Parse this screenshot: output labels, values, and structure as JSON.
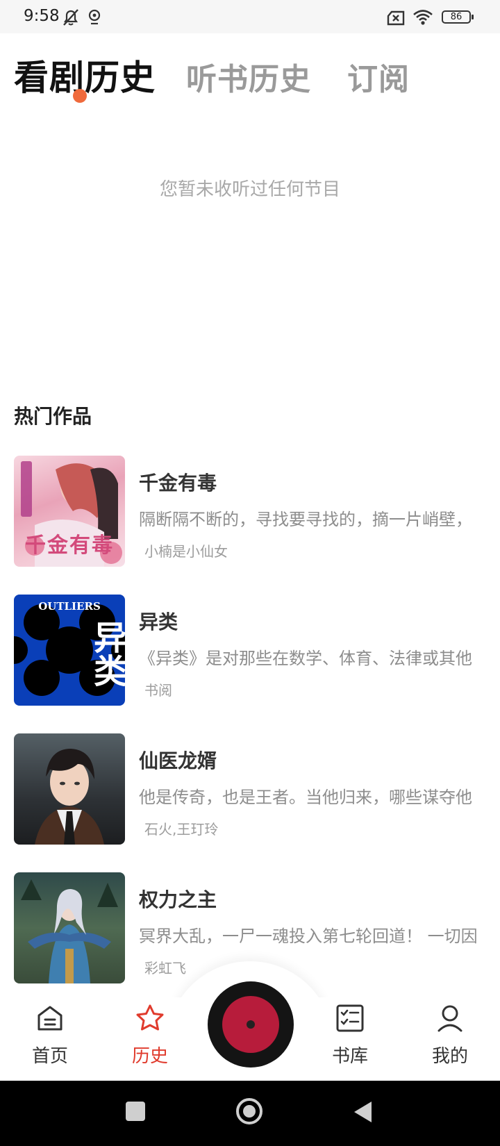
{
  "status_bar": {
    "time": "9:58",
    "battery": "86"
  },
  "tabs": [
    {
      "label": "看剧历史",
      "active": true
    },
    {
      "label": "听书历史",
      "active": false
    },
    {
      "label": "订阅",
      "active": false
    }
  ],
  "empty_message": "您暂未收听过任何节目",
  "section_title": "热门作品",
  "books": [
    {
      "title": "千金有毒",
      "desc": "隔断隔不断的，寻找要寻找的，摘一片峭壁，",
      "author": "小楠是小仙女",
      "cover_text": "千金有毒"
    },
    {
      "title": "异类",
      "desc": "《异类》是对那些在数学、体育、法律或其他",
      "author": "书阅",
      "cover_text": "异类",
      "cover_subtext": "OUTLIERS"
    },
    {
      "title": "仙医龙婿",
      "desc": "他是传奇，也是王者。当他归来，哪些谋夺他",
      "author": "石火,王玎玲"
    },
    {
      "title": "权力之主",
      "desc": "冥界大乱，一尸一魂投入第七轮回道！ 一切因",
      "author": "彩虹飞"
    }
  ],
  "bottom_nav": [
    {
      "label": "首页",
      "icon": "home-icon"
    },
    {
      "label": "历史",
      "icon": "star-icon",
      "active": true
    },
    {
      "label": "书库",
      "icon": "checklist-icon"
    },
    {
      "label": "我的",
      "icon": "user-icon"
    }
  ],
  "colors": {
    "accent": "#e03b2d",
    "indicator": "#ef6a3c",
    "disc": "#b71c3b"
  }
}
